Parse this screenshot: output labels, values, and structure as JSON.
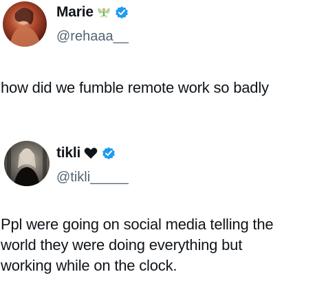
{
  "tweets": [
    {
      "display_name": "Marie",
      "name_emoji_icon": "fairy-emoji",
      "verified_icon": "verified-badge",
      "handle": "@rehaaa__",
      "text": "how did we fumble remote work so badly"
    },
    {
      "display_name": "tikli",
      "name_emoji_icon": "black-heart-emoji",
      "verified_icon": "verified-badge",
      "handle": "@tikli_____",
      "text": "Ppl were going on social media telling the\nworld they were doing everything but\nworking while on the clock."
    }
  ],
  "colors": {
    "text": "#0f1419",
    "handle": "#536471",
    "verified": "#1d9bf0"
  }
}
